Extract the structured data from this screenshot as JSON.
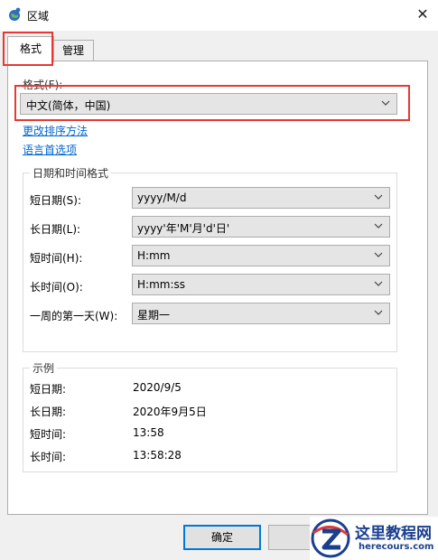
{
  "window": {
    "title": "区域",
    "close_glyph": "✕"
  },
  "tabs": [
    {
      "label": "格式",
      "active": true
    },
    {
      "label": "管理",
      "active": false
    }
  ],
  "format": {
    "label": "格式(F):",
    "selected": "中文(简体，中国)"
  },
  "links": {
    "change_sort": "更改排序方法",
    "language_prefs": "语言首选项"
  },
  "datetime_group": {
    "title": "日期和时间格式",
    "rows": [
      {
        "label": "短日期(S):",
        "value": "yyyy/M/d"
      },
      {
        "label": "长日期(L):",
        "value": "yyyy'年'M'月'd'日'"
      },
      {
        "label": "短时间(H):",
        "value": "H:mm"
      },
      {
        "label": "长时间(O):",
        "value": "H:mm:ss"
      },
      {
        "label": "一周的第一天(W):",
        "value": "星期一"
      }
    ]
  },
  "examples_group": {
    "title": "示例",
    "rows": [
      {
        "label": "短日期:",
        "value": "2020/9/5"
      },
      {
        "label": "长日期:",
        "value": "2020年9月5日"
      },
      {
        "label": "短时间:",
        "value": "13:58"
      },
      {
        "label": "长时间:",
        "value": "13:58:28"
      }
    ]
  },
  "buttons": {
    "ok": "确定"
  },
  "watermark": {
    "title": "这里教程网",
    "url": "herecours.com"
  },
  "colors": {
    "highlight": "#e53935",
    "link": "#0066cc",
    "accent": "#0078d7",
    "watermark": "#1a3f8f"
  },
  "icons": {
    "app": "region-globe-icon",
    "dropdown": "chevron-down-icon",
    "close": "close-icon"
  }
}
